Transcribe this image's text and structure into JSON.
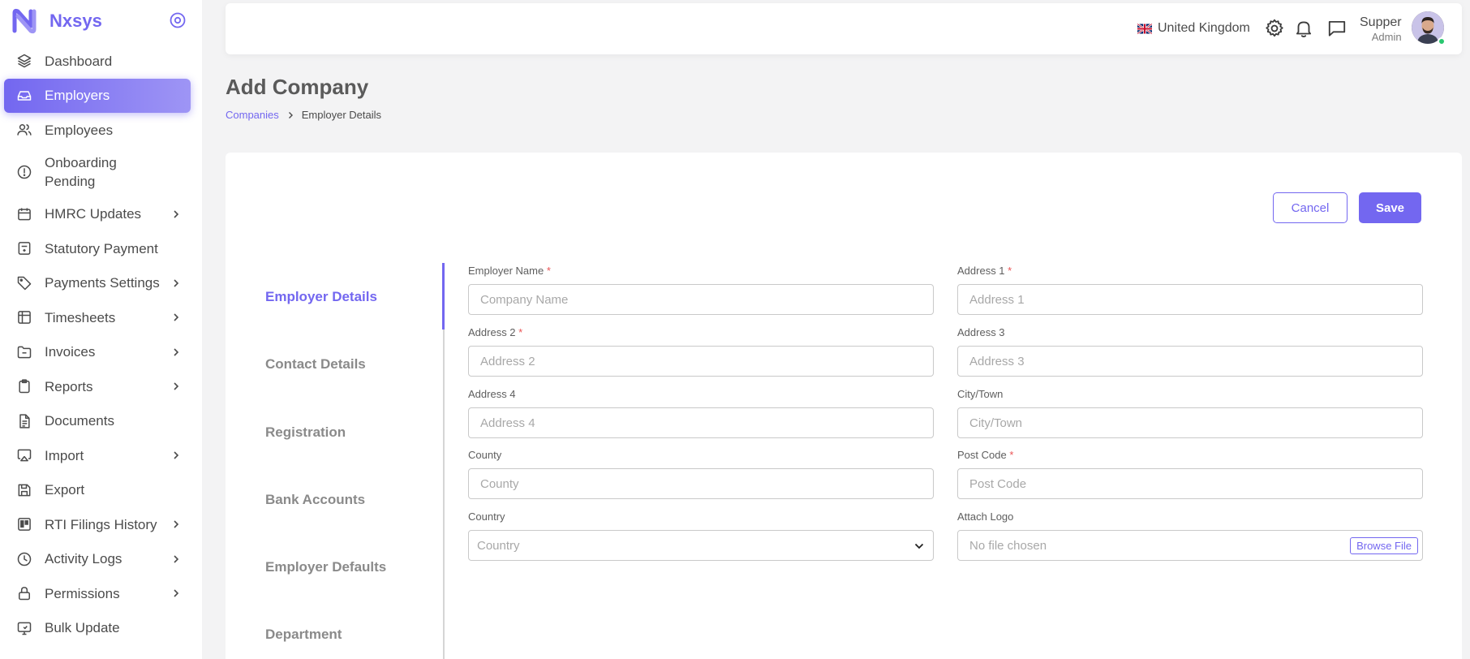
{
  "brand": {
    "name": "Nxsys"
  },
  "sidebar": {
    "items": [
      {
        "label": "Dashboard",
        "icon": "layers-icon",
        "has_submenu": false,
        "active": false
      },
      {
        "label": "Employers",
        "icon": "inbox-icon",
        "has_submenu": false,
        "active": true
      },
      {
        "label": "Employees",
        "icon": "users-icon",
        "has_submenu": false,
        "active": false
      },
      {
        "label": "Onboarding Pending",
        "icon": "alert-circle-icon",
        "has_submenu": false,
        "active": false
      },
      {
        "label": "HMRC Updates",
        "icon": "calendar-icon",
        "has_submenu": true,
        "active": false
      },
      {
        "label": "Statutory Payment",
        "icon": "calculator-icon",
        "has_submenu": false,
        "active": false
      },
      {
        "label": "Payments Settings",
        "icon": "tag-icon",
        "has_submenu": true,
        "active": false
      },
      {
        "label": "Timesheets",
        "icon": "table-icon",
        "has_submenu": true,
        "active": false
      },
      {
        "label": "Invoices",
        "icon": "folder-icon",
        "has_submenu": true,
        "active": false
      },
      {
        "label": "Reports",
        "icon": "clipboard-icon",
        "has_submenu": true,
        "active": false
      },
      {
        "label": "Documents",
        "icon": "document-icon",
        "has_submenu": false,
        "active": false
      },
      {
        "label": "Import",
        "icon": "airplay-icon",
        "has_submenu": true,
        "active": false
      },
      {
        "label": "Export",
        "icon": "save-icon",
        "has_submenu": false,
        "active": false
      },
      {
        "label": "RTI Filings History",
        "icon": "trello-icon",
        "has_submenu": true,
        "active": false
      },
      {
        "label": "Activity Logs",
        "icon": "clock-icon",
        "has_submenu": true,
        "active": false
      },
      {
        "label": "Permissions",
        "icon": "lock-icon",
        "has_submenu": true,
        "active": false
      },
      {
        "label": "Bulk Update",
        "icon": "monitor-icon",
        "has_submenu": false,
        "active": false
      }
    ]
  },
  "header": {
    "country": "United Kingdom",
    "user_name": "Supper",
    "user_role": "Admin"
  },
  "page": {
    "title": "Add Company",
    "breadcrumb": {
      "parent": "Companies",
      "current": "Employer Details"
    }
  },
  "actions": {
    "cancel_label": "Cancel",
    "save_label": "Save"
  },
  "tabs": [
    {
      "label": "Employer Details",
      "active": true
    },
    {
      "label": "Contact Details",
      "active": false
    },
    {
      "label": "Registration",
      "active": false
    },
    {
      "label": "Bank Accounts",
      "active": false
    },
    {
      "label": "Employer Defaults",
      "active": false
    },
    {
      "label": "Department",
      "active": false
    }
  ],
  "form": {
    "employer_name": {
      "label": "Employer Name",
      "required": "*",
      "placeholder": "Company Name",
      "value": ""
    },
    "address1": {
      "label": "Address 1",
      "required": "*",
      "placeholder": "Address 1",
      "value": ""
    },
    "address2": {
      "label": "Address 2",
      "required": "*",
      "placeholder": "Address 2",
      "value": ""
    },
    "address3": {
      "label": "Address 3",
      "placeholder": "Address 3",
      "value": ""
    },
    "address4": {
      "label": "Address 4",
      "placeholder": "Address 4",
      "value": ""
    },
    "city": {
      "label": "City/Town",
      "placeholder": "City/Town",
      "value": ""
    },
    "county": {
      "label": "County",
      "placeholder": "County",
      "value": ""
    },
    "postcode": {
      "label": "Post Code",
      "required": "*",
      "placeholder": "Post Code",
      "value": ""
    },
    "country": {
      "label": "Country",
      "selected": "Country"
    },
    "logo": {
      "label": "Attach Logo",
      "status": "No file chosen",
      "button": "Browse File"
    }
  },
  "colors": {
    "accent": "#7367f0",
    "required": "#ea5455",
    "online": "#28c76f"
  }
}
